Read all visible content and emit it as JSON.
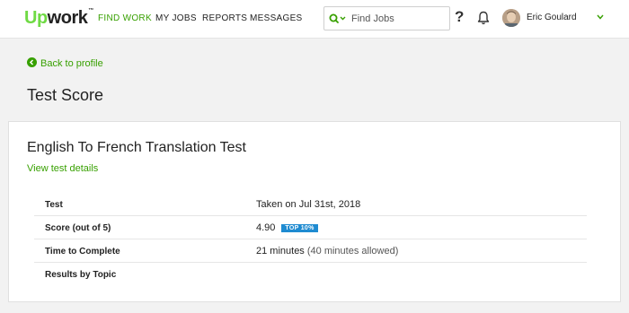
{
  "header": {
    "logo_up": "Up",
    "logo_work": "work",
    "logo_tm": "™",
    "nav": [
      "FIND WORK",
      "MY JOBS",
      "REPORTS",
      "MESSAGES"
    ],
    "active_nav": "FIND WORK",
    "search": {
      "placeholder": "Find Jobs",
      "icon": "search-icon"
    },
    "help": "?",
    "user_name": "Eric Goulard"
  },
  "back_link": "Back to profile",
  "page_title": "Test Score",
  "card": {
    "test_name": "English To French Translation Test",
    "details_link": "View test details",
    "rows": [
      {
        "label": "Test",
        "value": "Taken on Jul 31st, 2018"
      },
      {
        "label": "Score (out of 5)",
        "value": "4.90",
        "badge": "TOP 10%"
      },
      {
        "label": "Time to Complete",
        "value": "21 minutes",
        "extra": "(40 minutes allowed)"
      },
      {
        "label": "Results by Topic",
        "value": ""
      }
    ]
  },
  "colors": {
    "brand_green": "#37a000",
    "logo_green": "#6fda44",
    "badge_blue": "#1f8bd1"
  }
}
